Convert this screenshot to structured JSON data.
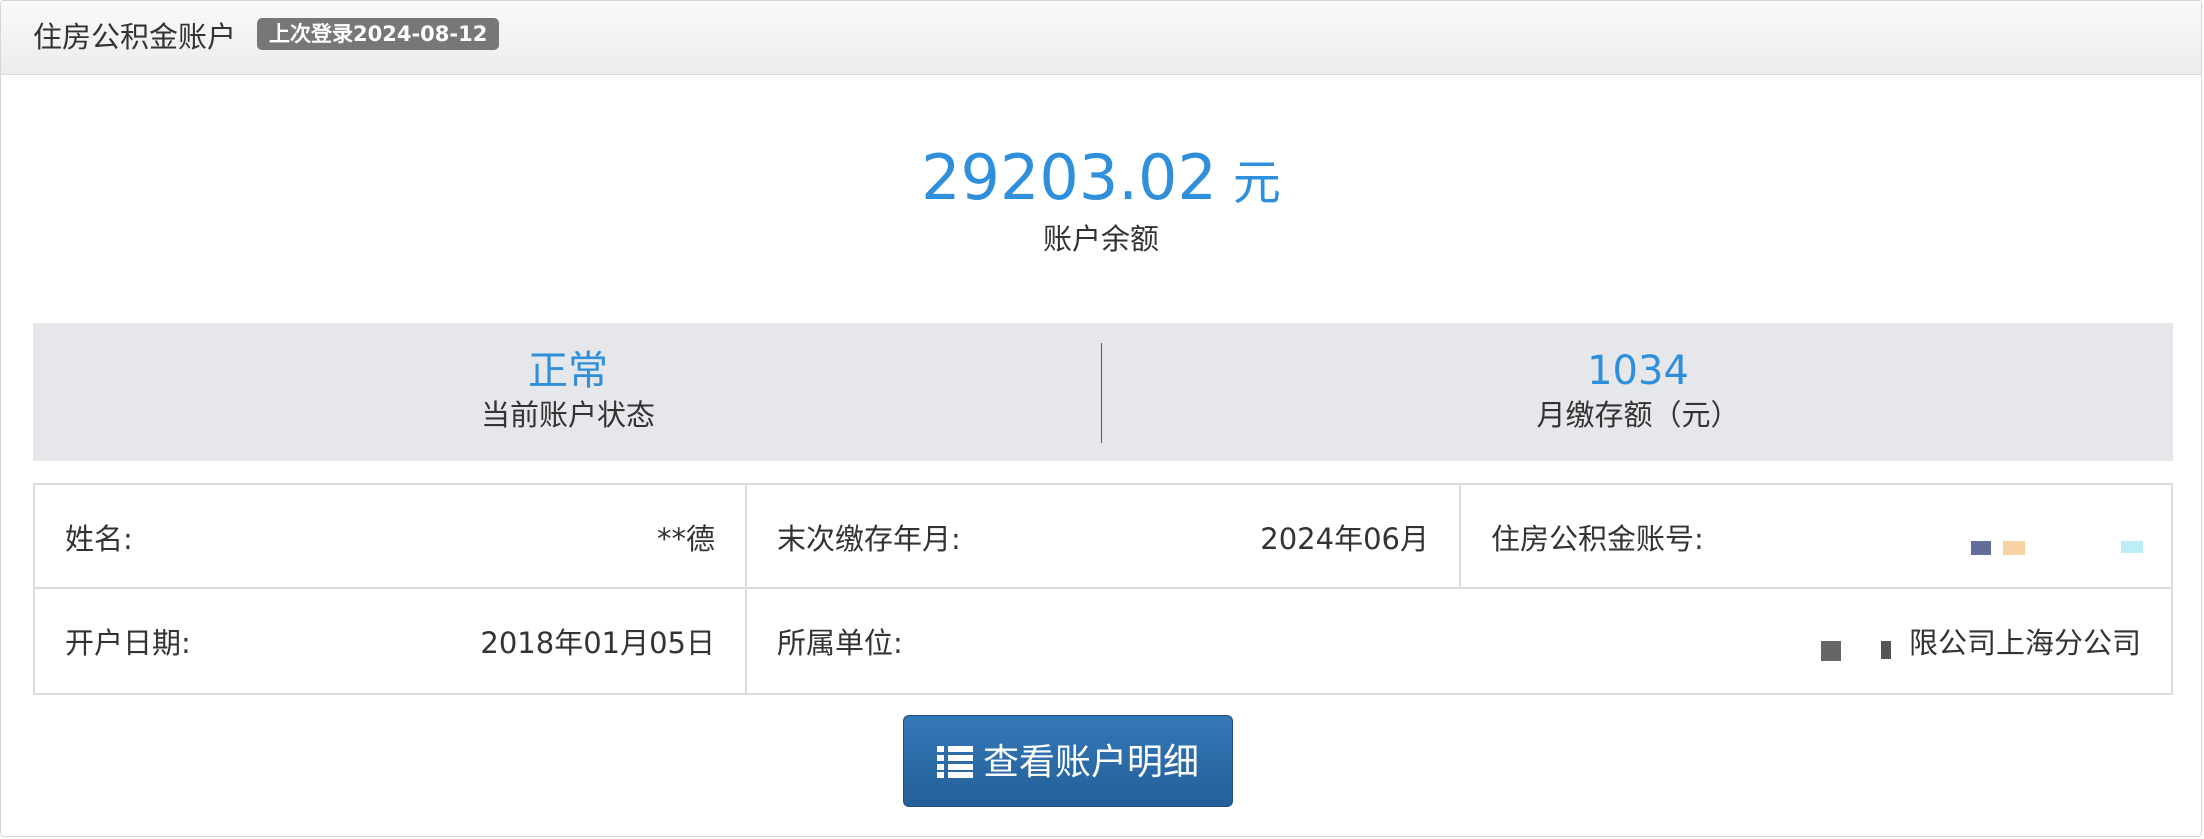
{
  "header": {
    "title": "住房公积金账户",
    "last_login": "上次登录2024-08-12"
  },
  "balance": {
    "amount": "29203.02",
    "unit": "元",
    "label": "账户余额"
  },
  "stats": {
    "status_value": "正常",
    "status_label": "当前账户状态",
    "monthly_value": "1034",
    "monthly_label": "月缴存额（元）"
  },
  "info": {
    "name_label": "姓名:",
    "name_value": "**德",
    "last_month_label": "末次缴存年月:",
    "last_month_value": "2024年06月",
    "account_no_label": "住房公积金账号:",
    "open_date_label": "开户日期:",
    "open_date_value": "2018年01月05日",
    "employer_label": "所属单位:",
    "employer_value": "限公司上海分公司"
  },
  "actions": {
    "detail_button": "查看账户明细"
  },
  "colors": {
    "accent": "#2f8fdb",
    "button": "#2a69a6",
    "badge": "#777777",
    "stats_bg": "#e6e7ea"
  },
  "icons": {
    "detail_button_icon": "list-icon"
  }
}
